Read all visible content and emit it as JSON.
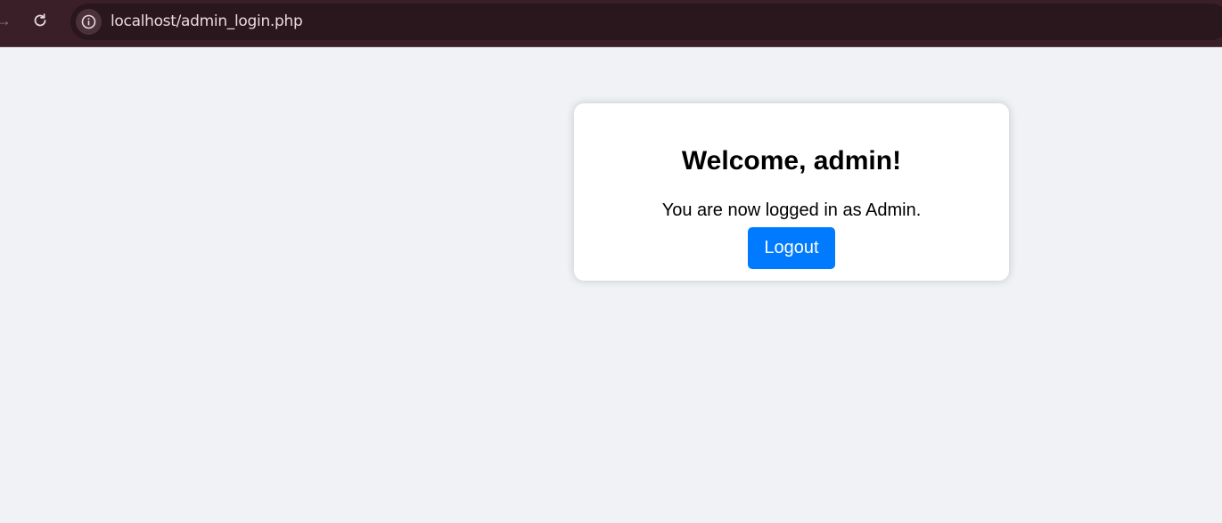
{
  "browser": {
    "url": "localhost/admin_login.php",
    "icons": {
      "forward": "forward-arrow-icon",
      "reload": "reload-icon",
      "site_info": "info-icon"
    }
  },
  "card": {
    "heading": "Welcome, admin!",
    "message": "You are now logged in as Admin.",
    "logout_label": "Logout"
  },
  "colors": {
    "browser_bar": "#3a1f28",
    "page_background": "#f0f2f5",
    "button": "#007bff"
  }
}
